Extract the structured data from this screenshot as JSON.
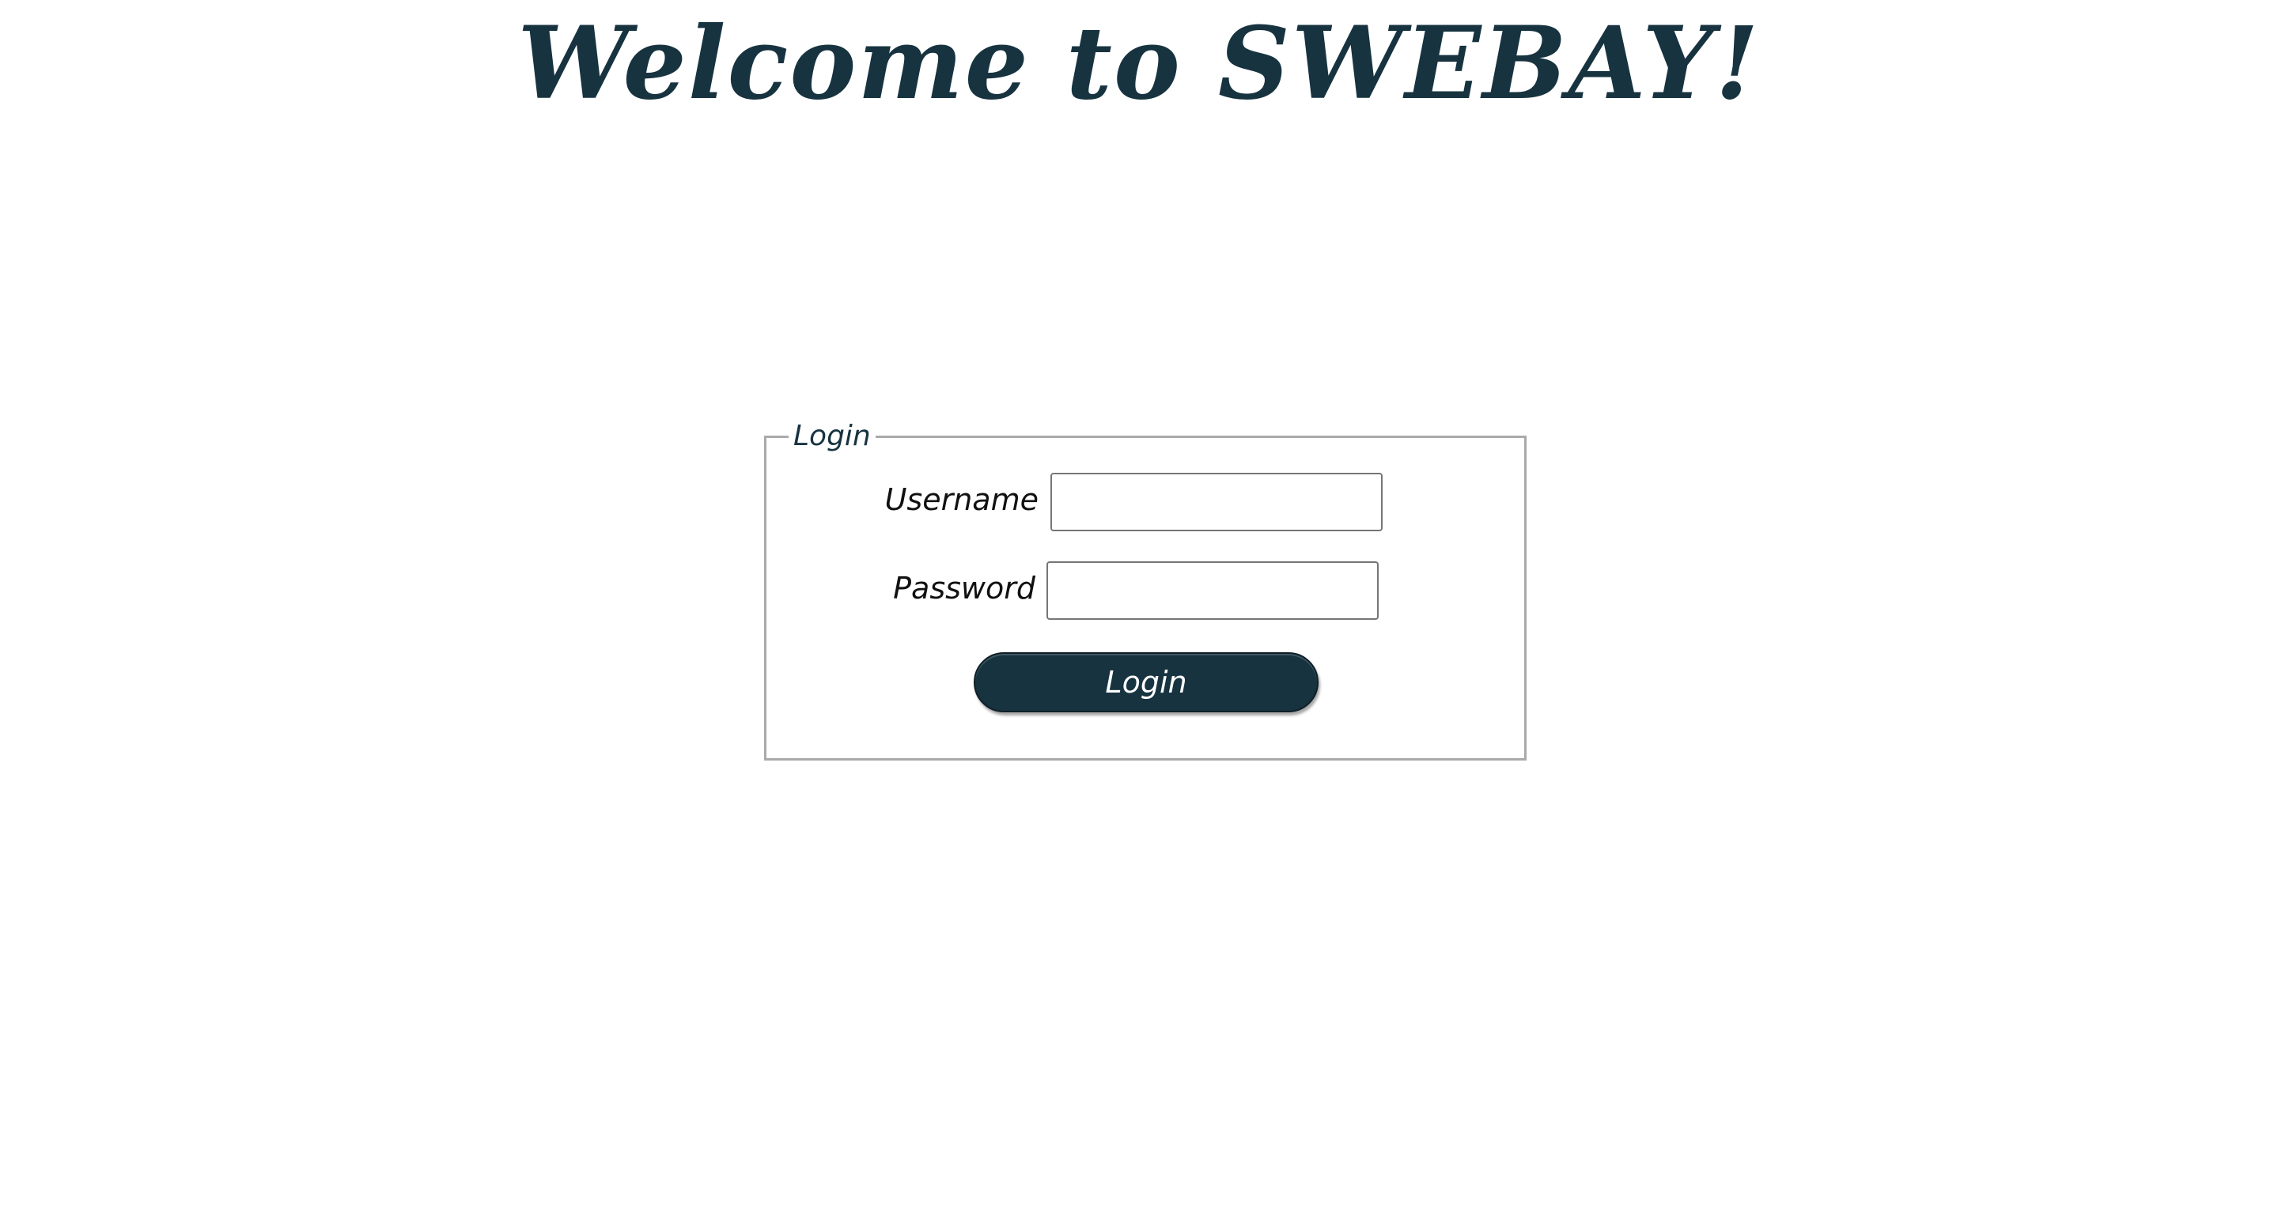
{
  "header": {
    "title": "Welcome to SWEBAY!"
  },
  "login_form": {
    "legend": "Login",
    "username_label": "Username",
    "username_value": "",
    "password_label": "Password",
    "password_value": "",
    "submit_label": "Login"
  },
  "colors": {
    "brand": "#173340",
    "background": "#ffffff",
    "border": "#aaaaaa"
  }
}
